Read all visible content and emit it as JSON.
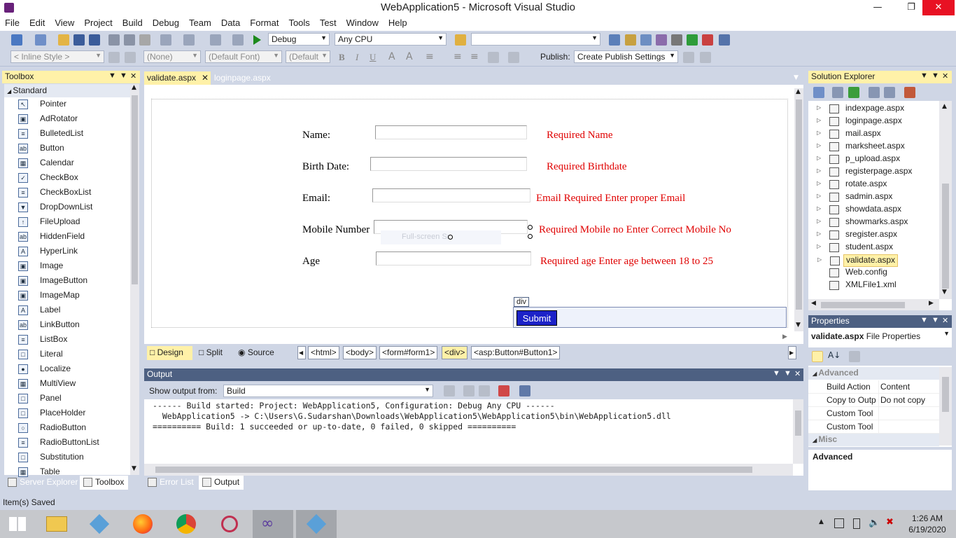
{
  "window": {
    "title": "WebApplication5 - Microsoft Visual Studio"
  },
  "menu": [
    "File",
    "Edit",
    "View",
    "Project",
    "Build",
    "Debug",
    "Team",
    "Data",
    "Format",
    "Tools",
    "Test",
    "Window",
    "Help"
  ],
  "toolbar1": {
    "config": "Debug",
    "platform": "Any CPU",
    "search": ""
  },
  "toolbar2": {
    "style": "< Inline Style >",
    "css_class": "(None)",
    "font": "(Default Font)",
    "size": "(Default",
    "publish_label": "Publish:",
    "publish_value": "Create Publish Settings"
  },
  "toolbox": {
    "title": "Toolbox",
    "group": "Standard",
    "items": [
      "Pointer",
      "AdRotator",
      "BulletedList",
      "Button",
      "Calendar",
      "CheckBox",
      "CheckBoxList",
      "DropDownList",
      "FileUpload",
      "HiddenField",
      "HyperLink",
      "Image",
      "ImageButton",
      "ImageMap",
      "Label",
      "LinkButton",
      "ListBox",
      "Literal",
      "Localize",
      "MultiView",
      "Panel",
      "PlaceHolder",
      "RadioButton",
      "RadioButtonList",
      "Substitution",
      "Table"
    ]
  },
  "left_tabs": {
    "server_explorer": "Server Explorer",
    "toolbox": "Toolbox"
  },
  "doc_tabs": {
    "active": "validate.aspx",
    "other": "loginpage.aspx"
  },
  "form": {
    "rows": [
      {
        "label": "Name:",
        "validator": "Required Name"
      },
      {
        "label": "Birth Date:",
        "validator": "Required Birthdate"
      },
      {
        "label": "Email:",
        "validator": "Email Required  Enter proper Email"
      },
      {
        "label": "Mobile Number",
        "validator": "Required Mobile no Enter Correct Mobile No"
      },
      {
        "label": "Age",
        "validator": "Required age Enter age between 18 to 25"
      }
    ],
    "ghost_text": "Full-screen Sn",
    "div_tag": "div",
    "submit_label": "Submit"
  },
  "view_buttons": {
    "design": "Design",
    "split": "Split",
    "source": "Source"
  },
  "breadcrumbs": [
    "<html>",
    "<body>",
    "<form#form1>",
    "<div>",
    "<asp:Button#Button1>"
  ],
  "output": {
    "title": "Output",
    "show_from_label": "Show output from:",
    "show_from_value": "Build",
    "lines": [
      "------ Build started: Project: WebApplication5, Configuration: Debug Any CPU ------",
      "  WebApplication5 -> C:\\Users\\G.Sudarshan\\Downloads\\WebApplication5\\WebApplication5\\bin\\WebApplication5.dll",
      "========== Build: 1 succeeded or up-to-date, 0 failed, 0 skipped =========="
    ]
  },
  "bottom_tabs": {
    "error_list": "Error List",
    "output": "Output"
  },
  "solution_explorer": {
    "title": "Solution Explorer",
    "files": [
      "indexpage.aspx",
      "loginpage.aspx",
      "mail.aspx",
      "marksheet.aspx",
      "p_upload.aspx",
      "registerpage.aspx",
      "rotate.aspx",
      "sadmin.aspx",
      "showdata.aspx",
      "showmarks.aspx",
      "sregister.aspx",
      "student.aspx",
      "validate.aspx",
      "Web.config",
      "XMLFile1.xml"
    ],
    "selected": "validate.aspx"
  },
  "properties": {
    "title": "Properties",
    "object": "validate.aspx",
    "object_type": "File Properties",
    "cat_advanced": "Advanced",
    "rows": [
      {
        "name": "Build Action",
        "value": "Content"
      },
      {
        "name": "Copy to Outp",
        "value": "Do not copy"
      },
      {
        "name": "Custom Tool",
        "value": ""
      },
      {
        "name": "Custom Tool",
        "value": ""
      }
    ],
    "cat_misc": "Misc",
    "desc_title": "Advanced"
  },
  "status": {
    "text": "Item(s) Saved"
  },
  "taskbar": {
    "time": "1:26 AM",
    "date": "6/19/2020"
  },
  "colors": {
    "accent": "#fff1a8",
    "panel_header": "#4d6082",
    "validator": "#e00000",
    "submit_bg": "#1c22c8",
    "close_red": "#e81123"
  }
}
